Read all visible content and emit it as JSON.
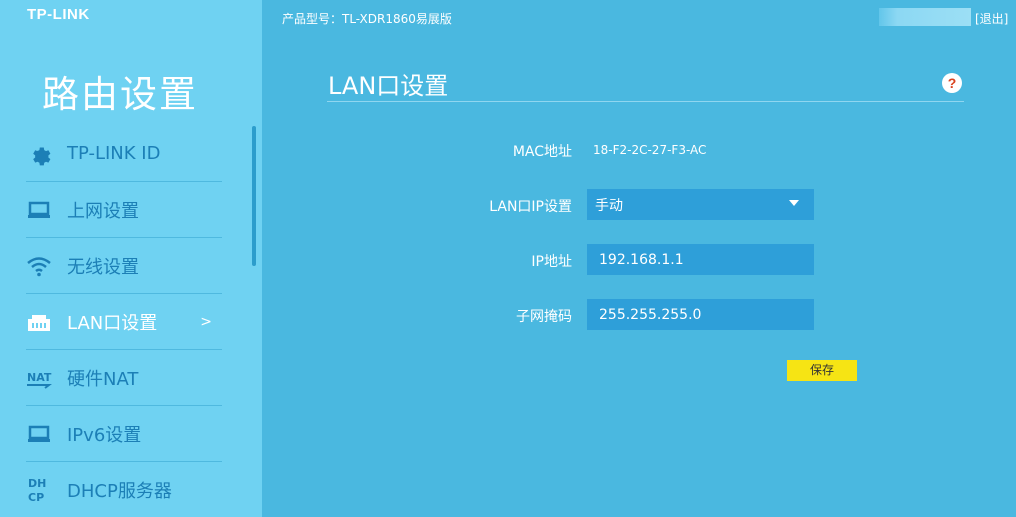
{
  "brand": {
    "logo_text": "TP-LINK"
  },
  "header": {
    "model_label": "产品型号：TL-XDR1860易展版",
    "logout_label": "[退出]"
  },
  "sidebar": {
    "title": "路由设置",
    "items": [
      {
        "label": "TP-LINK ID",
        "icon": "gear-icon",
        "active": false
      },
      {
        "label": "上网设置",
        "icon": "laptop-icon",
        "active": false
      },
      {
        "label": "无线设置",
        "icon": "wifi-icon",
        "active": false
      },
      {
        "label": "LAN口设置",
        "icon": "lan-port-icon",
        "active": true,
        "arrow": ">"
      },
      {
        "label": "硬件NAT",
        "icon": "nat-icon",
        "active": false
      },
      {
        "label": "IPv6设置",
        "icon": "laptop-icon",
        "active": false
      },
      {
        "label": "DHCP服务器",
        "icon": "dhcp-icon",
        "active": false
      }
    ]
  },
  "main": {
    "title": "LAN口设置",
    "help_glyph": "?",
    "mac": {
      "label": "MAC地址",
      "value": "18-F2-2C-27-F3-AC"
    },
    "lan_ip_mode": {
      "label": "LAN口IP设置",
      "value": "手动"
    },
    "ip": {
      "label": "IP地址",
      "value": "192.168.1.1"
    },
    "subnet": {
      "label": "子网掩码",
      "value": "255.255.255.0"
    },
    "save_label": "保存"
  },
  "colors": {
    "sidebar_bg": "#6fd2f2",
    "main_bg": "#4ab8e0",
    "field_bg": "#2e9fd9",
    "save_bg": "#f6e414",
    "menu_text": "#1c7fb6"
  }
}
